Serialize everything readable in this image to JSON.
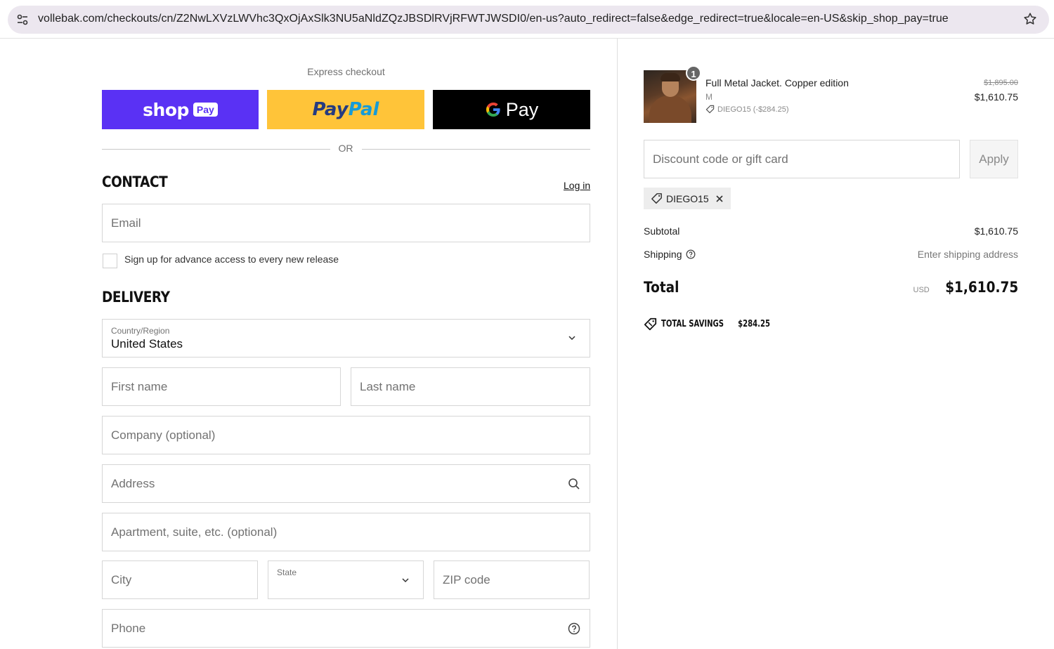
{
  "browser": {
    "url": "vollebak.com/checkouts/cn/Z2NwLXVzLWVhc3QxOjAxSlk3NU5aNldZQzJBSDlRVjRFWTJWSDI0/en-us?auto_redirect=false&edge_redirect=true&locale=en-US&skip_shop_pay=true"
  },
  "express": {
    "label": "Express checkout",
    "shop_pay": {
      "word": "shop",
      "tag": "Pay"
    },
    "paypal": {
      "part1": "Pay",
      "part2": "Pal"
    },
    "gpay": {
      "word": "Pay"
    },
    "or_label": "OR"
  },
  "contact": {
    "title": "CONTACT",
    "login": "Log in",
    "email_placeholder": "Email",
    "signup_label": "Sign up for advance access to every new release"
  },
  "delivery": {
    "title": "DELIVERY",
    "country_label": "Country/Region",
    "country_value": "United States",
    "first_name_placeholder": "First name",
    "last_name_placeholder": "Last name",
    "company_placeholder": "Company (optional)",
    "address_placeholder": "Address",
    "apartment_placeholder": "Apartment, suite, etc. (optional)",
    "city_placeholder": "City",
    "state_label": "State",
    "zip_placeholder": "ZIP code",
    "phone_placeholder": "Phone"
  },
  "order": {
    "item": {
      "quantity": "1",
      "name": "Full Metal Jacket. Copper edition",
      "variant": "M",
      "discount": "DIEGO15 (-$284.25)",
      "original_price": "$1,895.00",
      "price": "$1,610.75"
    },
    "discount_placeholder": "Discount code or gift card",
    "apply_label": "Apply",
    "applied_code": "DIEGO15",
    "subtotal_label": "Subtotal",
    "subtotal_value": "$1,610.75",
    "shipping_label": "Shipping",
    "shipping_value": "Enter shipping address",
    "total_label": "Total",
    "currency": "USD",
    "total_value": "$1,610.75",
    "savings_label": "TOTAL SAVINGS",
    "savings_value": "$284.25"
  },
  "colors": {
    "shop_pay": "#5a31f4",
    "paypal": "#ffc439",
    "gpay": "#000000"
  }
}
